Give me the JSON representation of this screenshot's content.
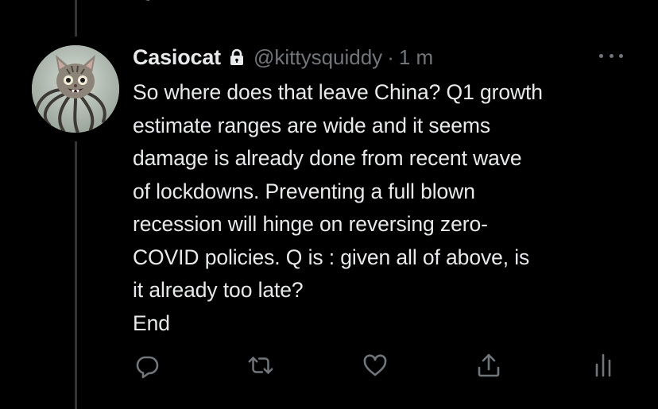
{
  "tweet": {
    "author_name": "Casiocat",
    "handle": "@kittysquiddy",
    "separator": "·",
    "time": "1 m",
    "text": "So where does that leave China? Q1 growth\nestimate ranges are wide and it seems\ndamage is already done from recent wave\nof lockdowns. Preventing a full blown\nrecession will hinge on reversing zero-\nCOVID policies. Q is : given all of above, is\nit already too late?\nEnd"
  },
  "icons": {
    "protected": "lock-icon",
    "more": "more-dots-icon",
    "reply": "reply-icon",
    "retweet": "retweet-icon",
    "like": "heart-icon",
    "share": "share-icon",
    "analytics": "analytics-icon"
  },
  "colors": {
    "background": "#000000",
    "text": "#e7e9ea",
    "muted": "#71767b",
    "thread_line": "#333639"
  }
}
